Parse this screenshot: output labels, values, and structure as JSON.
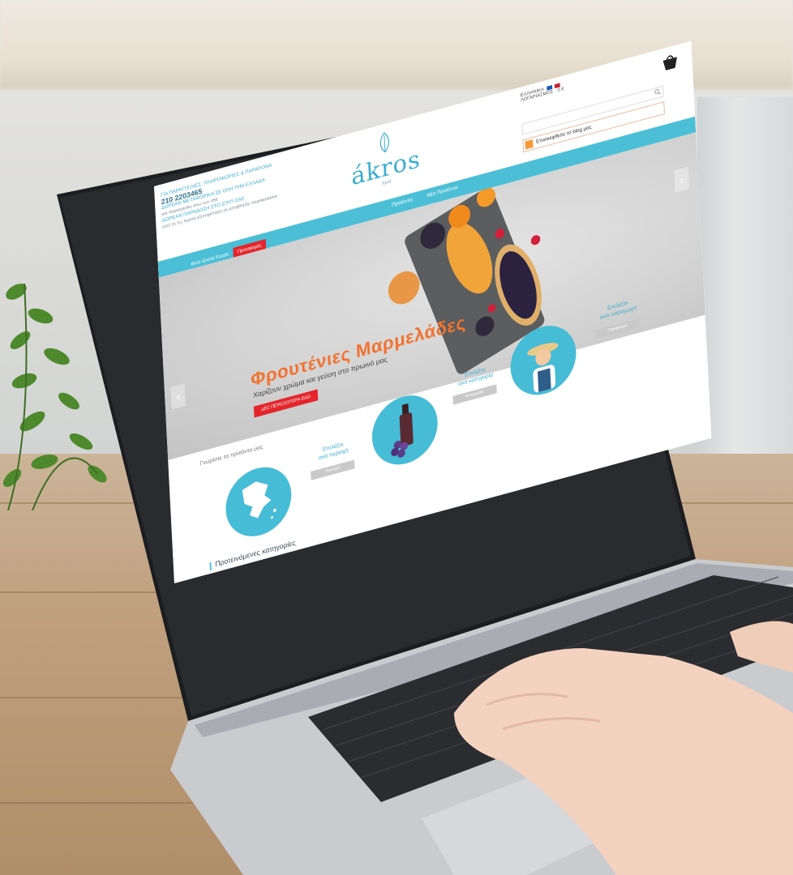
{
  "site": {
    "contact": {
      "line1": "ΓΙΑ ΠΑΡΑΓΓΕΛΙΕΣ, ΠΛΗΡΟΦΟΡΙΕΣ & ΠΑΡΑΠΟΝΑ",
      "phone": "210 2203465",
      "line2": "ΔΩΡΕΑΝ ΜΕΤΑΦΟΡΙΚΑ ΣΕ ΟΛΗ ΤΗΝ ΕΛΛΑΔΑ",
      "line2_note": "για παραγγελίες άνω των 45€",
      "line3": "ΔΩΡΕΑΝ ΠΑΡΑΔΟΣΗ ΣΤΟ ΣΠΙΤΙ ΣΑΣ",
      "line3_note": "από τη 1η. Άμεση εξυπηρέτηση σε μεταβλητές παρακαλείστε"
    },
    "logo": {
      "word": "ákros",
      "sub": "food"
    },
    "lang_label": "ΕΛΛΗΝΙΚΑ",
    "account_label": "ΛΟΓΑΡΙΑΣΜΟΣ · 0 €",
    "blog_label": "Επισκεφθείτε το blog μας",
    "nav": {
      "tab_a": "Best Greek Foods",
      "tab_b": "Προσφορές",
      "link1": "Προϊόντα",
      "link2": "Νέα Προϊόντα"
    },
    "hero": {
      "title": "Φρουτένιες Μαρμελάδες",
      "subtitle": "Χαρίζουν χρώμα και γεύση στο πρωινό μας",
      "button": "ΔΕΣ ΠΕΡΙΣΣΟΤΕΡΑ ΕΔΩ"
    },
    "browse": {
      "title": "Γνωρίστε τα προϊόντα μας",
      "region_label": "Επιλέξτε\nανά περιοχή",
      "region_btn": "Περιοχές",
      "category_label": "Επιλέξτε\nανά κατηγορία",
      "category_btn": "Κατηγορίες",
      "producer_label": "Επιλέξτε\nανά παραγωγό",
      "producer_btn": "Παραγωγοί"
    },
    "featured_categories": "Προτεινόμενες κατηγορίες"
  },
  "colors": {
    "accent": "#4cbfd6",
    "orange": "#f27331",
    "red": "#e4252c"
  }
}
